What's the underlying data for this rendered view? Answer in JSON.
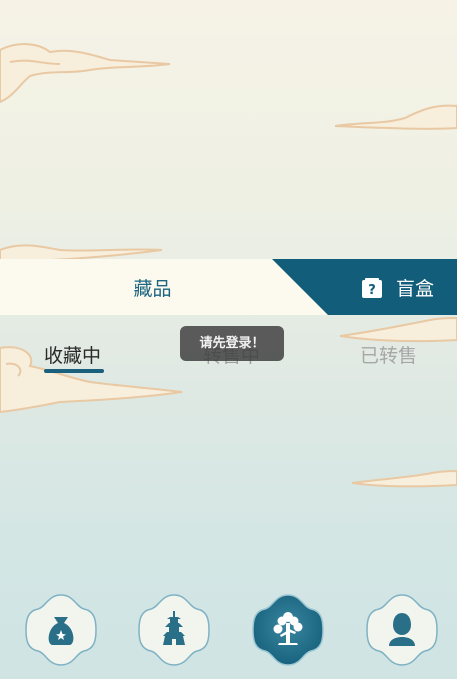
{
  "tabs": {
    "collection": "藏品",
    "blind_box": "盲盒"
  },
  "sub_tabs": {
    "collecting": "收藏中",
    "selling": "转售中",
    "sold": "已转售"
  },
  "toast": "请先登录！",
  "bottom_nav": [
    {
      "icon": "money-bag-icon"
    },
    {
      "icon": "tower-icon"
    },
    {
      "icon": "tree-icon",
      "active": true
    },
    {
      "icon": "user-icon"
    }
  ],
  "colors": {
    "accent": "#125d79",
    "tab_bg": "#fcfaee",
    "cloud_fill": "#f7eedc",
    "cloud_stroke": "#e9c9a4"
  }
}
